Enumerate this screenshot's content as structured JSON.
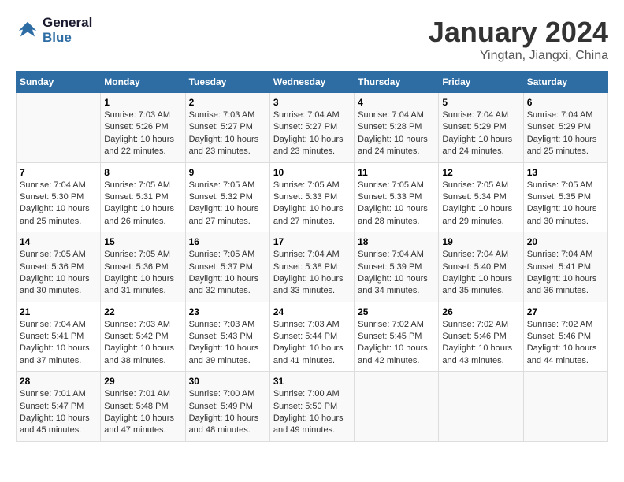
{
  "header": {
    "logo_line1": "General",
    "logo_line2": "Blue",
    "month_title": "January 2024",
    "location": "Yingtan, Jiangxi, China"
  },
  "days_of_week": [
    "Sunday",
    "Monday",
    "Tuesday",
    "Wednesday",
    "Thursday",
    "Friday",
    "Saturday"
  ],
  "weeks": [
    [
      {
        "day": "",
        "info": ""
      },
      {
        "day": "1",
        "info": "Sunrise: 7:03 AM\nSunset: 5:26 PM\nDaylight: 10 hours\nand 22 minutes."
      },
      {
        "day": "2",
        "info": "Sunrise: 7:03 AM\nSunset: 5:27 PM\nDaylight: 10 hours\nand 23 minutes."
      },
      {
        "day": "3",
        "info": "Sunrise: 7:04 AM\nSunset: 5:27 PM\nDaylight: 10 hours\nand 23 minutes."
      },
      {
        "day": "4",
        "info": "Sunrise: 7:04 AM\nSunset: 5:28 PM\nDaylight: 10 hours\nand 24 minutes."
      },
      {
        "day": "5",
        "info": "Sunrise: 7:04 AM\nSunset: 5:29 PM\nDaylight: 10 hours\nand 24 minutes."
      },
      {
        "day": "6",
        "info": "Sunrise: 7:04 AM\nSunset: 5:29 PM\nDaylight: 10 hours\nand 25 minutes."
      }
    ],
    [
      {
        "day": "7",
        "info": "Sunrise: 7:04 AM\nSunset: 5:30 PM\nDaylight: 10 hours\nand 25 minutes."
      },
      {
        "day": "8",
        "info": "Sunrise: 7:05 AM\nSunset: 5:31 PM\nDaylight: 10 hours\nand 26 minutes."
      },
      {
        "day": "9",
        "info": "Sunrise: 7:05 AM\nSunset: 5:32 PM\nDaylight: 10 hours\nand 27 minutes."
      },
      {
        "day": "10",
        "info": "Sunrise: 7:05 AM\nSunset: 5:33 PM\nDaylight: 10 hours\nand 27 minutes."
      },
      {
        "day": "11",
        "info": "Sunrise: 7:05 AM\nSunset: 5:33 PM\nDaylight: 10 hours\nand 28 minutes."
      },
      {
        "day": "12",
        "info": "Sunrise: 7:05 AM\nSunset: 5:34 PM\nDaylight: 10 hours\nand 29 minutes."
      },
      {
        "day": "13",
        "info": "Sunrise: 7:05 AM\nSunset: 5:35 PM\nDaylight: 10 hours\nand 30 minutes."
      }
    ],
    [
      {
        "day": "14",
        "info": "Sunrise: 7:05 AM\nSunset: 5:36 PM\nDaylight: 10 hours\nand 30 minutes."
      },
      {
        "day": "15",
        "info": "Sunrise: 7:05 AM\nSunset: 5:36 PM\nDaylight: 10 hours\nand 31 minutes."
      },
      {
        "day": "16",
        "info": "Sunrise: 7:05 AM\nSunset: 5:37 PM\nDaylight: 10 hours\nand 32 minutes."
      },
      {
        "day": "17",
        "info": "Sunrise: 7:04 AM\nSunset: 5:38 PM\nDaylight: 10 hours\nand 33 minutes."
      },
      {
        "day": "18",
        "info": "Sunrise: 7:04 AM\nSunset: 5:39 PM\nDaylight: 10 hours\nand 34 minutes."
      },
      {
        "day": "19",
        "info": "Sunrise: 7:04 AM\nSunset: 5:40 PM\nDaylight: 10 hours\nand 35 minutes."
      },
      {
        "day": "20",
        "info": "Sunrise: 7:04 AM\nSunset: 5:41 PM\nDaylight: 10 hours\nand 36 minutes."
      }
    ],
    [
      {
        "day": "21",
        "info": "Sunrise: 7:04 AM\nSunset: 5:41 PM\nDaylight: 10 hours\nand 37 minutes."
      },
      {
        "day": "22",
        "info": "Sunrise: 7:03 AM\nSunset: 5:42 PM\nDaylight: 10 hours\nand 38 minutes."
      },
      {
        "day": "23",
        "info": "Sunrise: 7:03 AM\nSunset: 5:43 PM\nDaylight: 10 hours\nand 39 minutes."
      },
      {
        "day": "24",
        "info": "Sunrise: 7:03 AM\nSunset: 5:44 PM\nDaylight: 10 hours\nand 41 minutes."
      },
      {
        "day": "25",
        "info": "Sunrise: 7:02 AM\nSunset: 5:45 PM\nDaylight: 10 hours\nand 42 minutes."
      },
      {
        "day": "26",
        "info": "Sunrise: 7:02 AM\nSunset: 5:46 PM\nDaylight: 10 hours\nand 43 minutes."
      },
      {
        "day": "27",
        "info": "Sunrise: 7:02 AM\nSunset: 5:46 PM\nDaylight: 10 hours\nand 44 minutes."
      }
    ],
    [
      {
        "day": "28",
        "info": "Sunrise: 7:01 AM\nSunset: 5:47 PM\nDaylight: 10 hours\nand 45 minutes."
      },
      {
        "day": "29",
        "info": "Sunrise: 7:01 AM\nSunset: 5:48 PM\nDaylight: 10 hours\nand 47 minutes."
      },
      {
        "day": "30",
        "info": "Sunrise: 7:00 AM\nSunset: 5:49 PM\nDaylight: 10 hours\nand 48 minutes."
      },
      {
        "day": "31",
        "info": "Sunrise: 7:00 AM\nSunset: 5:50 PM\nDaylight: 10 hours\nand 49 minutes."
      },
      {
        "day": "",
        "info": ""
      },
      {
        "day": "",
        "info": ""
      },
      {
        "day": "",
        "info": ""
      }
    ]
  ]
}
